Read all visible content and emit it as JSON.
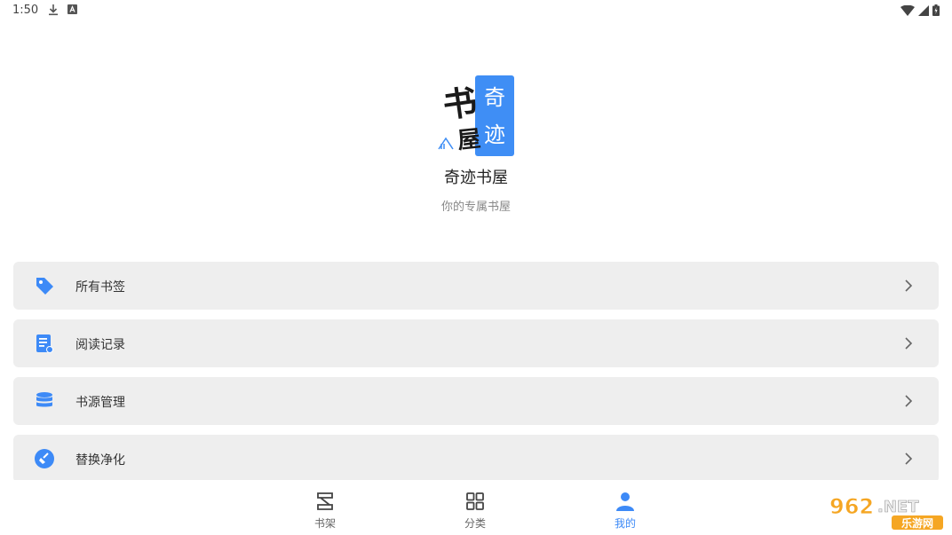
{
  "status_bar": {
    "time": "1:50"
  },
  "logo": {
    "char_shu": "书",
    "char_wu": "屋",
    "char_qi": "奇",
    "char_ji": "迹"
  },
  "header": {
    "title": "奇迹书屋",
    "subtitle": "你的专属书屋"
  },
  "menu": [
    {
      "label": "所有书签",
      "icon": "tag-icon"
    },
    {
      "label": "阅读记录",
      "icon": "document-icon"
    },
    {
      "label": "书源管理",
      "icon": "database-icon"
    },
    {
      "label": "替换净化",
      "icon": "broom-icon"
    }
  ],
  "bottom_nav": [
    {
      "label": "书架",
      "icon": "bookshelf-icon",
      "active": false
    },
    {
      "label": "分类",
      "icon": "grid-icon",
      "active": false
    },
    {
      "label": "我的",
      "icon": "person-icon",
      "active": true
    }
  ],
  "watermark": {
    "brand": "962.NET",
    "sub": "乐游网"
  },
  "colors": {
    "accent": "#3d8af7",
    "menu_bg": "#eeeeee",
    "text": "#333333"
  }
}
